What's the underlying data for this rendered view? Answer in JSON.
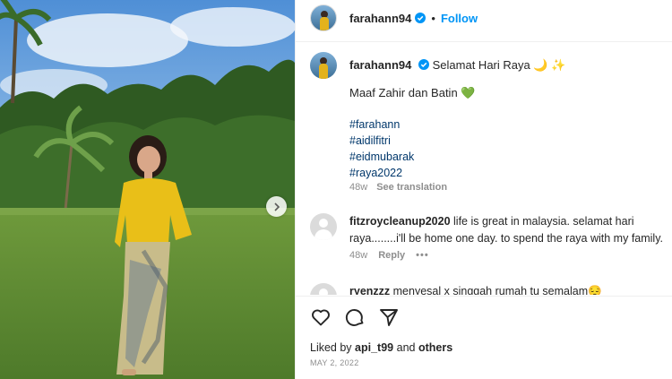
{
  "post": {
    "username": "farahann94",
    "dot": "•",
    "follow_label": "Follow"
  },
  "caption": {
    "username": "farahann94",
    "text": "Selamat Hari Raya 🌙 ✨",
    "line2": "Maaf Zahir dan Batin 💚",
    "hashtags": [
      "#farahann",
      "#aidilfitri",
      "#eidmubarak",
      "#raya2022"
    ],
    "age": "48w",
    "see_translation": "See translation"
  },
  "comments": [
    {
      "username": "fitzroycleanup2020",
      "text": "life is great in malaysia. selamat hari raya........i'll be home one day. to spend the raya with my family.",
      "age": "48w",
      "reply": "Reply",
      "more": "•••"
    },
    {
      "username": "ryenzzz",
      "text": "menyesal x singgah rumah tu semalam😔"
    }
  ],
  "footer": {
    "liked_by_prefix": "Liked by",
    "liked_by_user": "api_t99",
    "and": "and",
    "others": "others",
    "date": "MAY 2, 2022"
  },
  "colors": {
    "accent": "#0095f6",
    "hashtag": "#00376b",
    "muted": "#8e8e8e",
    "text": "#262626"
  },
  "icons": [
    "chevron-right-icon",
    "verified-badge-icon",
    "heart-icon",
    "comment-icon",
    "share-icon"
  ]
}
